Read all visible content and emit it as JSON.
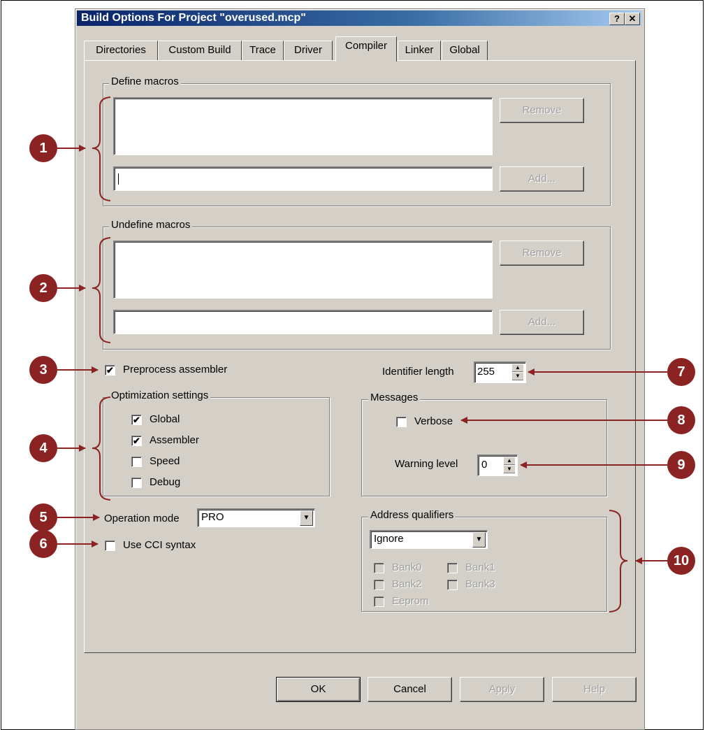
{
  "window": {
    "title": "Build Options For Project \"overused.mcp\"",
    "help_btn": "?",
    "close_btn": "✕"
  },
  "tabs": [
    {
      "label": "Directories"
    },
    {
      "label": "Custom Build"
    },
    {
      "label": "Trace"
    },
    {
      "label": "Driver"
    },
    {
      "label": "Compiler",
      "active": true
    },
    {
      "label": "Linker"
    },
    {
      "label": "Global"
    }
  ],
  "define_macros": {
    "legend": "Define macros",
    "remove_label": "Remove",
    "add_label": "Add...",
    "input_value": ""
  },
  "undefine_macros": {
    "legend": "Undefine macros",
    "remove_label": "Remove",
    "add_label": "Add...",
    "input_value": ""
  },
  "preprocess_assembler": {
    "label": "Preprocess assembler",
    "checked": true
  },
  "identifier_length": {
    "label": "Identifier length",
    "value": "255"
  },
  "optimization": {
    "legend": "Optimization settings",
    "items": [
      {
        "label": "Global",
        "checked": true
      },
      {
        "label": "Assembler",
        "checked": true
      },
      {
        "label": "Speed",
        "checked": false
      },
      {
        "label": "Debug",
        "checked": false
      }
    ]
  },
  "messages": {
    "legend": "Messages",
    "verbose": {
      "label": "Verbose",
      "checked": false
    },
    "warning_level": {
      "label": "Warning level",
      "value": "0"
    }
  },
  "operation_mode": {
    "label": "Operation mode",
    "value": "PRO"
  },
  "cci_syntax": {
    "label": "Use CCI syntax",
    "checked": false
  },
  "address_qualifiers": {
    "legend": "Address qualifiers",
    "value": "Ignore",
    "banks": [
      {
        "label": "Bank0"
      },
      {
        "label": "Bank1"
      },
      {
        "label": "Bank2"
      },
      {
        "label": "Bank3"
      },
      {
        "label": "Eeprom"
      }
    ]
  },
  "footer": {
    "ok": "OK",
    "cancel": "Cancel",
    "apply": "Apply",
    "help": "Help"
  },
  "callouts": [
    "1",
    "2",
    "3",
    "4",
    "5",
    "6",
    "7",
    "8",
    "9",
    "10"
  ],
  "colors": {
    "callout": "#8b2323",
    "title_bar": "#0a246a",
    "dialog_face": "#d4d0c8"
  }
}
